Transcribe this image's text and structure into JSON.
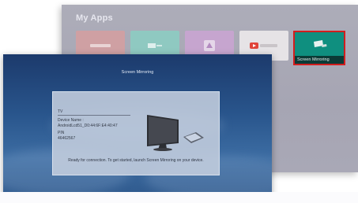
{
  "apps": {
    "title": "My Apps",
    "tiles": [
      {
        "label": "",
        "color": "#cfa0a3"
      },
      {
        "label": "",
        "color": "#8fc9c1"
      },
      {
        "label": "",
        "color": "#c6a5cf"
      },
      {
        "label": "",
        "color": "#e6e3e6"
      }
    ],
    "selected_tile": {
      "label": "Screen Mirroring",
      "color": "#0f8f7f",
      "border_color": "#d21d1d"
    }
  },
  "mirroring": {
    "title": "Screen Mirroring",
    "section": "TV",
    "device_name_label": "Device Name :",
    "device_name_value": "AndroidLcd51_D0:44:6F:E4:40:47",
    "pin_label": "PIN",
    "pin_value": "46462567",
    "footer": "Ready for connection. To get started, launch Screen Mirroring on your device.",
    "icons": [
      "tv-icon",
      "phone-icon"
    ]
  },
  "colors": {
    "accent_selection": "#d21d1d",
    "mirror_bg": "#29558c",
    "dialog_bg": "#c4cede"
  }
}
